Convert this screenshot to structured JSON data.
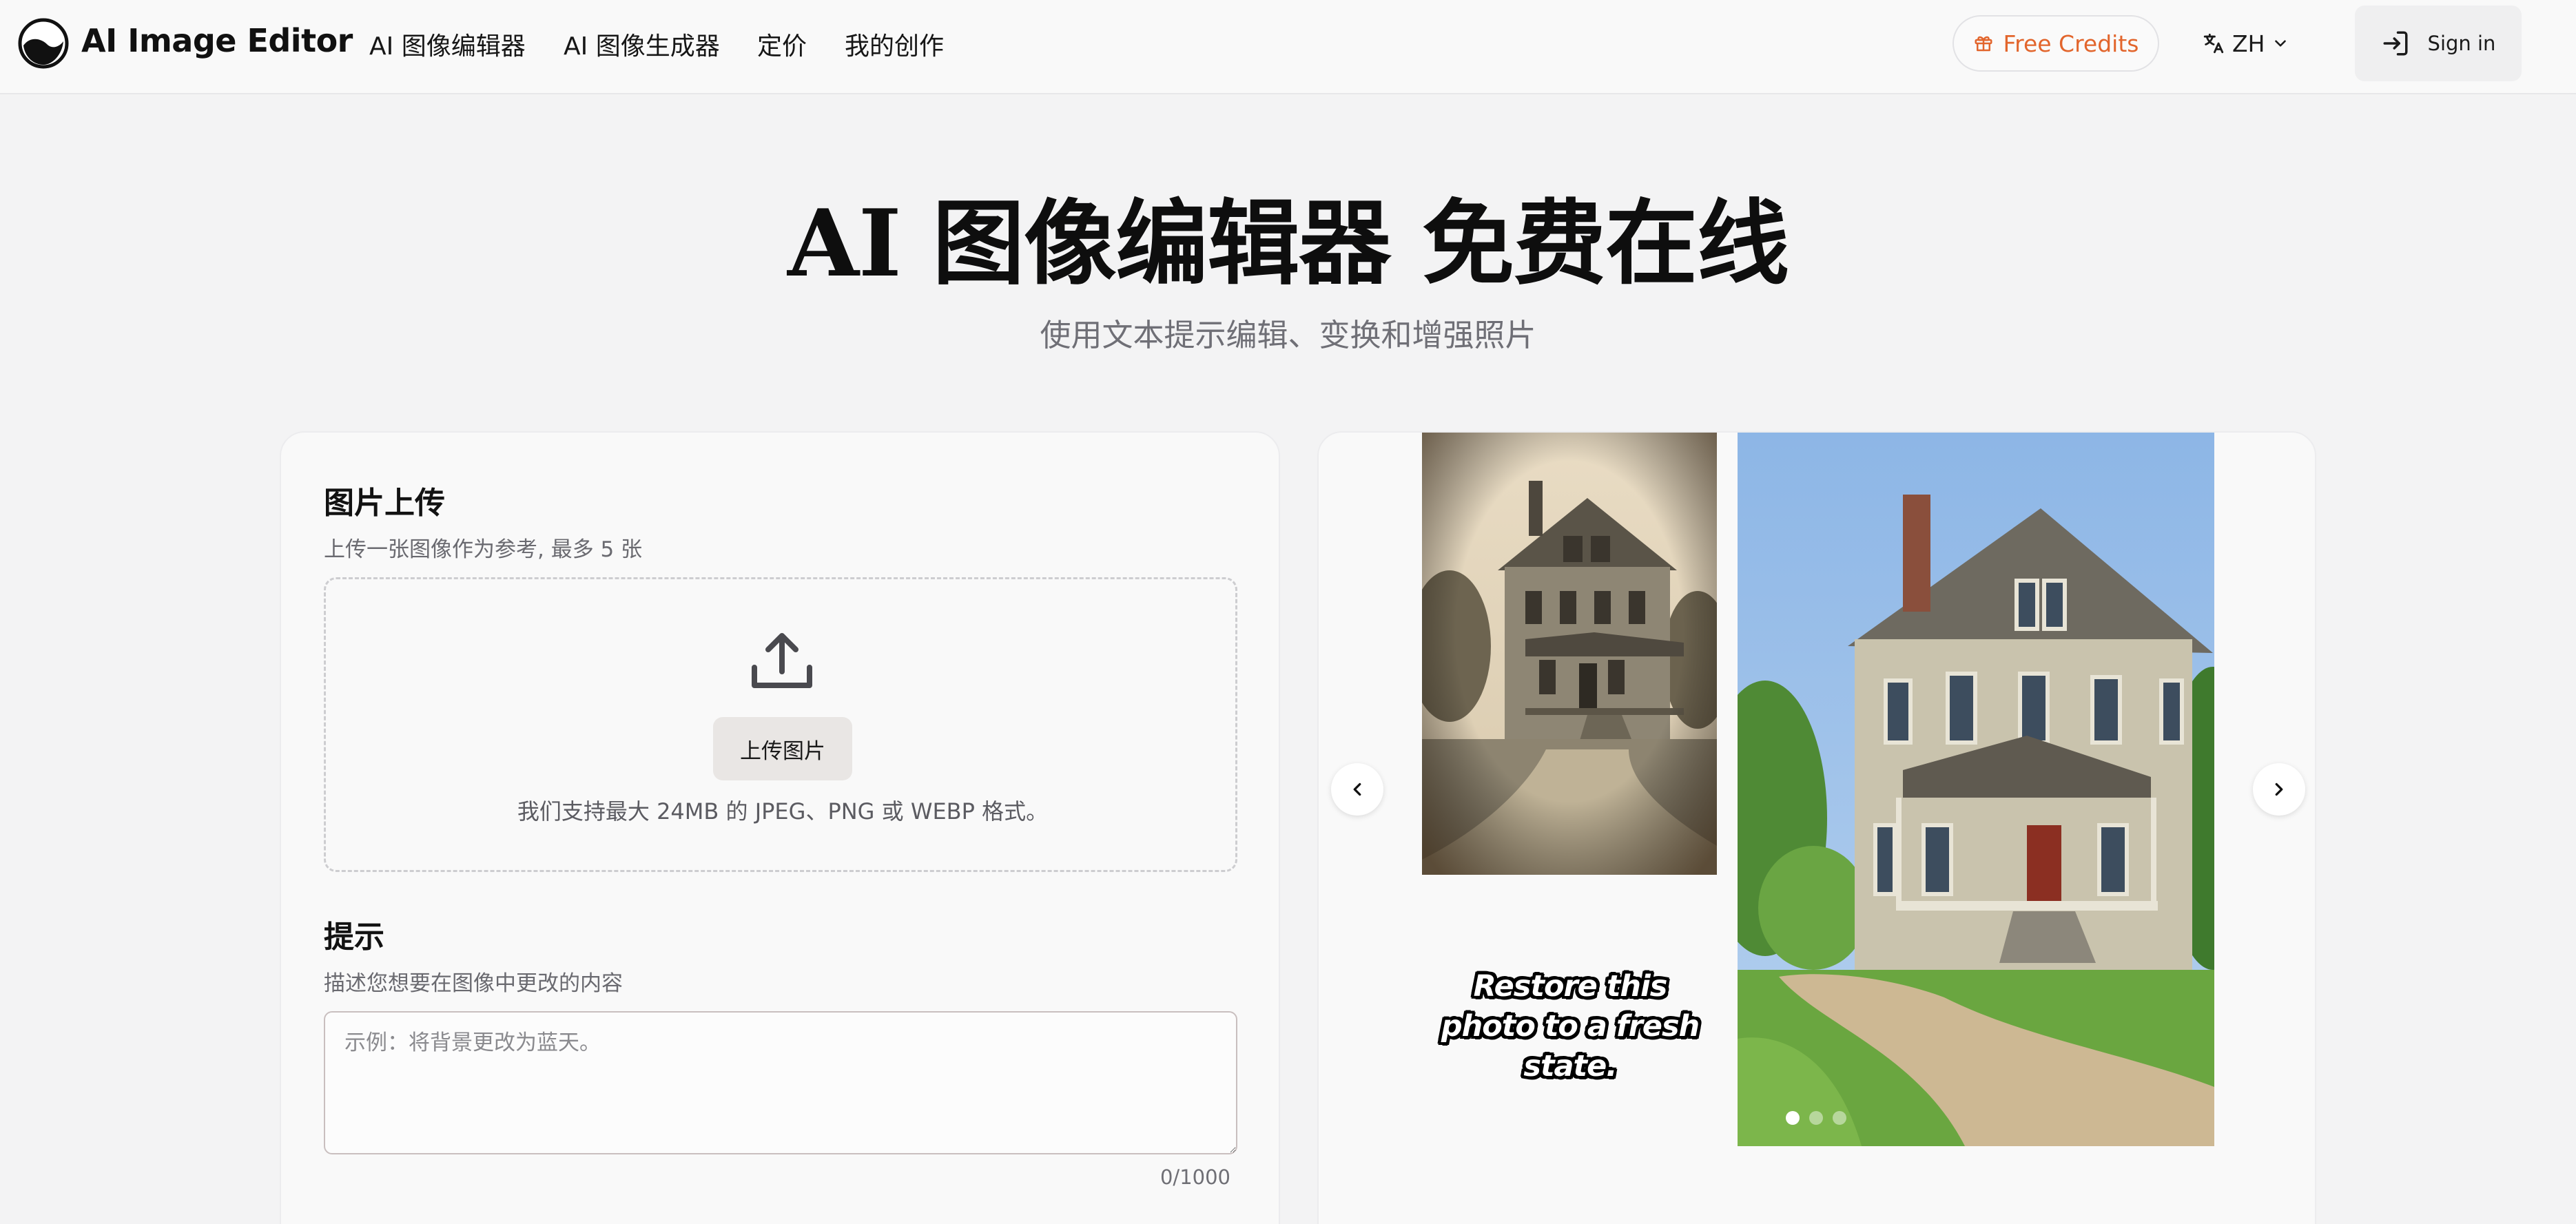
{
  "header": {
    "brand": "AI Image Editor",
    "nav": [
      {
        "label": "AI 图像编辑器"
      },
      {
        "label": "AI 图像生成器"
      },
      {
        "label": "定价"
      },
      {
        "label": "我的创作"
      }
    ],
    "credits_label": "Free Credits",
    "language_label": "ZH",
    "signin_label": "Sign in"
  },
  "hero": {
    "title": "AI 图像编辑器 免费在线",
    "subtitle": "使用文本提示编辑、变换和增强照片"
  },
  "upload": {
    "title": "图片上传",
    "description": "上传一张图像作为参考, 最多 5 张",
    "button_label": "上传图片",
    "hint": "我们支持最大 24MB 的 JPEG、PNG 或 WEBP 格式。"
  },
  "prompt": {
    "title": "提示",
    "description": "描述您想要在图像中更改的内容",
    "placeholder": "示例：将背景更改为蓝天。",
    "counter": "0/1000"
  },
  "carousel": {
    "caption": "Restore this photo to a fresh state.",
    "slide_count": 3,
    "active_slide": 1
  },
  "colors": {
    "accent": "#e2652c",
    "background": "#f3f3f4",
    "card": "#f9f9f9"
  },
  "icons": [
    "logo-icon",
    "gift-icon",
    "translate-icon",
    "chevron-down-icon",
    "sign-in-icon",
    "upload-icon",
    "chevron-left-icon",
    "chevron-right-icon"
  ]
}
